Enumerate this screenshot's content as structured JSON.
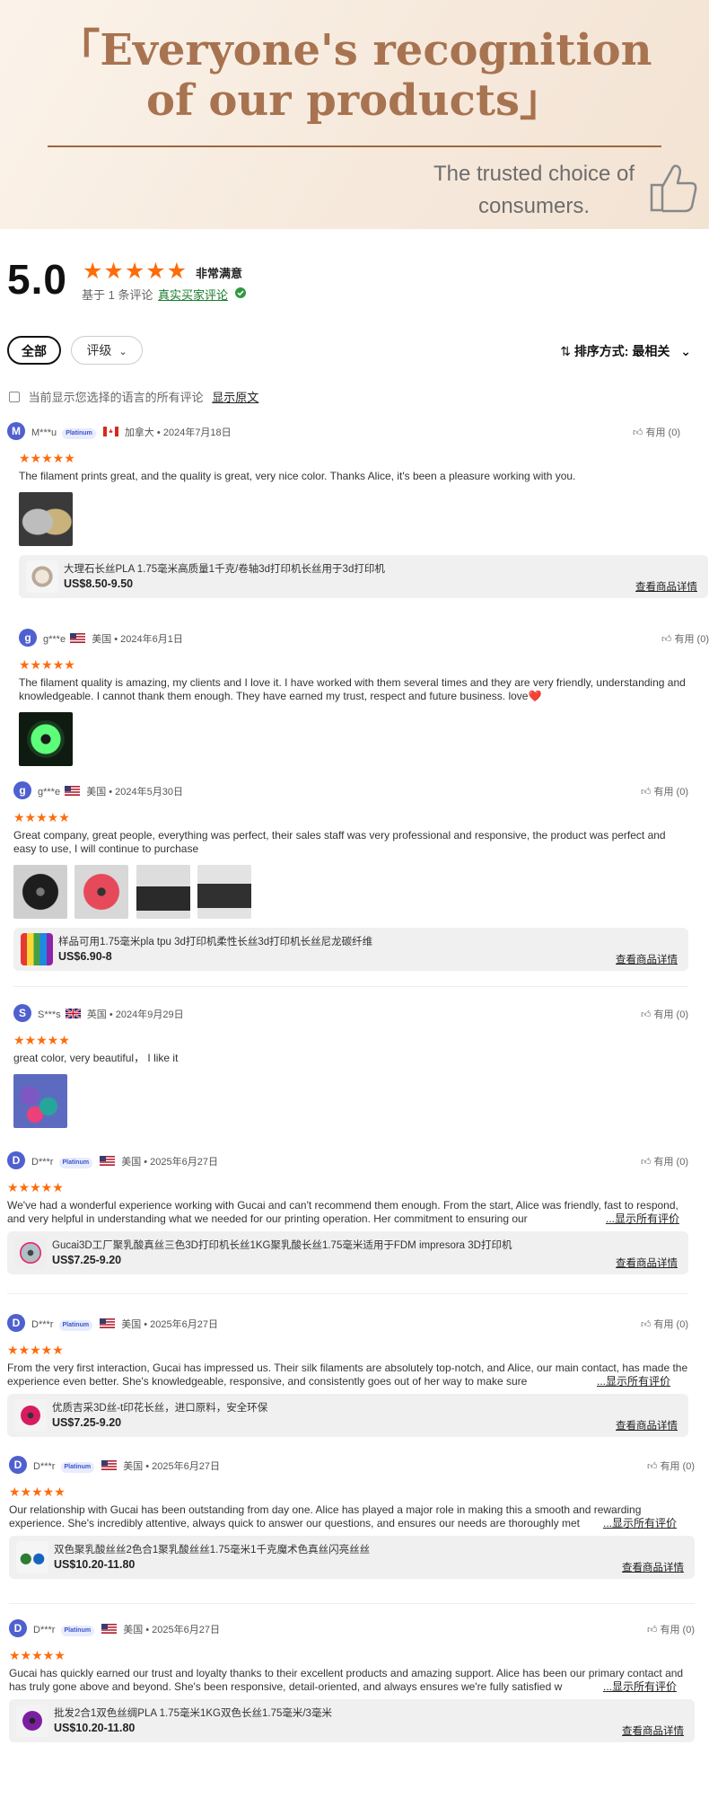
{
  "hero": {
    "title": "「Everyone's recognition of our products」",
    "subtitle": "The trusted choice of consumers.",
    "icon": "thumbs-up-icon"
  },
  "summary": {
    "score": "5.0",
    "stars": "★★★★★",
    "satisfaction": "非常满意",
    "based_on": "基于 1 条评论",
    "real_buyer": "真实买家评论",
    "star_color": "#fd6c0c"
  },
  "filters": {
    "all": "全部",
    "rating": "评级",
    "sort": "排序方式: 最相关"
  },
  "lang_note": {
    "text": "当前显示您选择的语言的所有评论",
    "show_original": "显示原文"
  },
  "reviews": [
    {
      "initial": "M",
      "user": "M***u",
      "badge": "Platinum",
      "flag": "ca",
      "country": "加拿大",
      "date": "2024年7月18日",
      "helpful": "有用 (0)",
      "stars": "★★★★★",
      "text": "The filament prints great, and the quality is great, very nice color. Thanks Alice, it's been a pleasure working with you.",
      "more": "",
      "product": {
        "name": "大理石长丝PLA 1.75毫米高质量1千克/卷轴3d打印机长丝用于3d打印机",
        "price": "US$8.50-9.50",
        "link": "查看商品详情"
      }
    },
    {
      "initial": "g",
      "user": "g***e",
      "badge": "",
      "flag": "us",
      "country": "美国",
      "date": "2024年6月1日",
      "helpful": "有用 (0)",
      "stars": "★★★★★",
      "text": "The filament quality is amazing, my clients and I love it. I have worked with them several times and they are very friendly, understanding and knowledgeable. I cannot thank them enough. They have earned my trust, respect and future business. love❤️",
      "more": ""
    },
    {
      "initial": "g",
      "user": "g***e",
      "badge": "",
      "flag": "us",
      "country": "美国",
      "date": "2024年5月30日",
      "helpful": "有用 (0)",
      "stars": "★★★★★",
      "text": "Great company, great people, everything was perfect, their sales staff was very professional and responsive, the product was perfect and easy to use, I will continue to purchase",
      "more": "",
      "product": {
        "name": "样品可用1.75毫米pla tpu 3d打印机柔性长丝3d打印机长丝尼龙碳纤维",
        "price": "US$6.90-8",
        "link": "查看商品详情"
      }
    },
    {
      "initial": "S",
      "user": "S***s",
      "badge": "",
      "flag": "gb",
      "country": "英国",
      "date": "2024年9月29日",
      "helpful": "有用 (0)",
      "stars": "★★★★★",
      "text": "great color, very beautiful， I like it",
      "more": ""
    },
    {
      "initial": "D",
      "user": "D***r",
      "badge": "Platinum",
      "flag": "us",
      "country": "美国",
      "date": "2025年6月27日",
      "helpful": "有用 (0)",
      "stars": "★★★★★",
      "text": "We've had a wonderful experience working with Gucai and can't recommend them enough. From the start, Alice was friendly, fast to respond, and very helpful in understanding what we needed for our printing operation. Her commitment to ensuring our",
      "more": "...显示所有评价",
      "product": {
        "name": "Gucai3D工厂聚乳酸真丝三色3D打印机长丝1KG聚乳酸长丝1.75毫米适用于FDM impresora 3D打印机",
        "price": "US$7.25-9.20",
        "link": "查看商品详情"
      }
    },
    {
      "initial": "D",
      "user": "D***r",
      "badge": "Platinum",
      "flag": "us",
      "country": "美国",
      "date": "2025年6月27日",
      "helpful": "有用 (0)",
      "stars": "★★★★★",
      "text": "From the very first interaction, Gucai has impressed us. Their silk filaments are absolutely top-notch, and Alice, our main contact, has made the experience even better. She's knowledgeable, responsive, and consistently goes out of her way to make sure",
      "more": "...显示所有评价",
      "product": {
        "name": "优质吉采3D丝-t印花长丝，进口原料，安全环保",
        "price": "US$7.25-9.20",
        "link": "查看商品详情"
      }
    },
    {
      "initial": "D",
      "user": "D***r",
      "badge": "Platinum",
      "flag": "us",
      "country": "美国",
      "date": "2025年6月27日",
      "helpful": "有用 (0)",
      "stars": "★★★★★",
      "text": "Our relationship with Gucai has been outstanding from day one. Alice has played a major role in making this a smooth and rewarding experience. She's incredibly attentive, always quick to answer our questions, and ensures our needs are thoroughly met",
      "more": "...显示所有评价",
      "product": {
        "name": "双色聚乳酸丝丝2色合1聚乳酸丝丝1.75毫米1千克魔术色真丝闪亮丝丝",
        "price": "US$10.20-11.80",
        "link": "查看商品详情"
      }
    },
    {
      "initial": "D",
      "user": "D***r",
      "badge": "Platinum",
      "flag": "us",
      "country": "美国",
      "date": "2025年6月27日",
      "helpful": "有用 (0)",
      "stars": "★★★★★",
      "text": "Gucai has quickly earned our trust and loyalty thanks to their excellent products and amazing support. Alice has been our primary contact and has truly gone above and beyond. She's been responsive, detail-oriented, and always ensures we're fully satisfied w",
      "more": "...显示所有评价",
      "product": {
        "name": "批发2合1双色丝绸PLA 1.75毫米1KG双色长丝1.75毫米/3毫米",
        "price": "US$10.20-11.80",
        "link": "查看商品详情"
      }
    }
  ]
}
